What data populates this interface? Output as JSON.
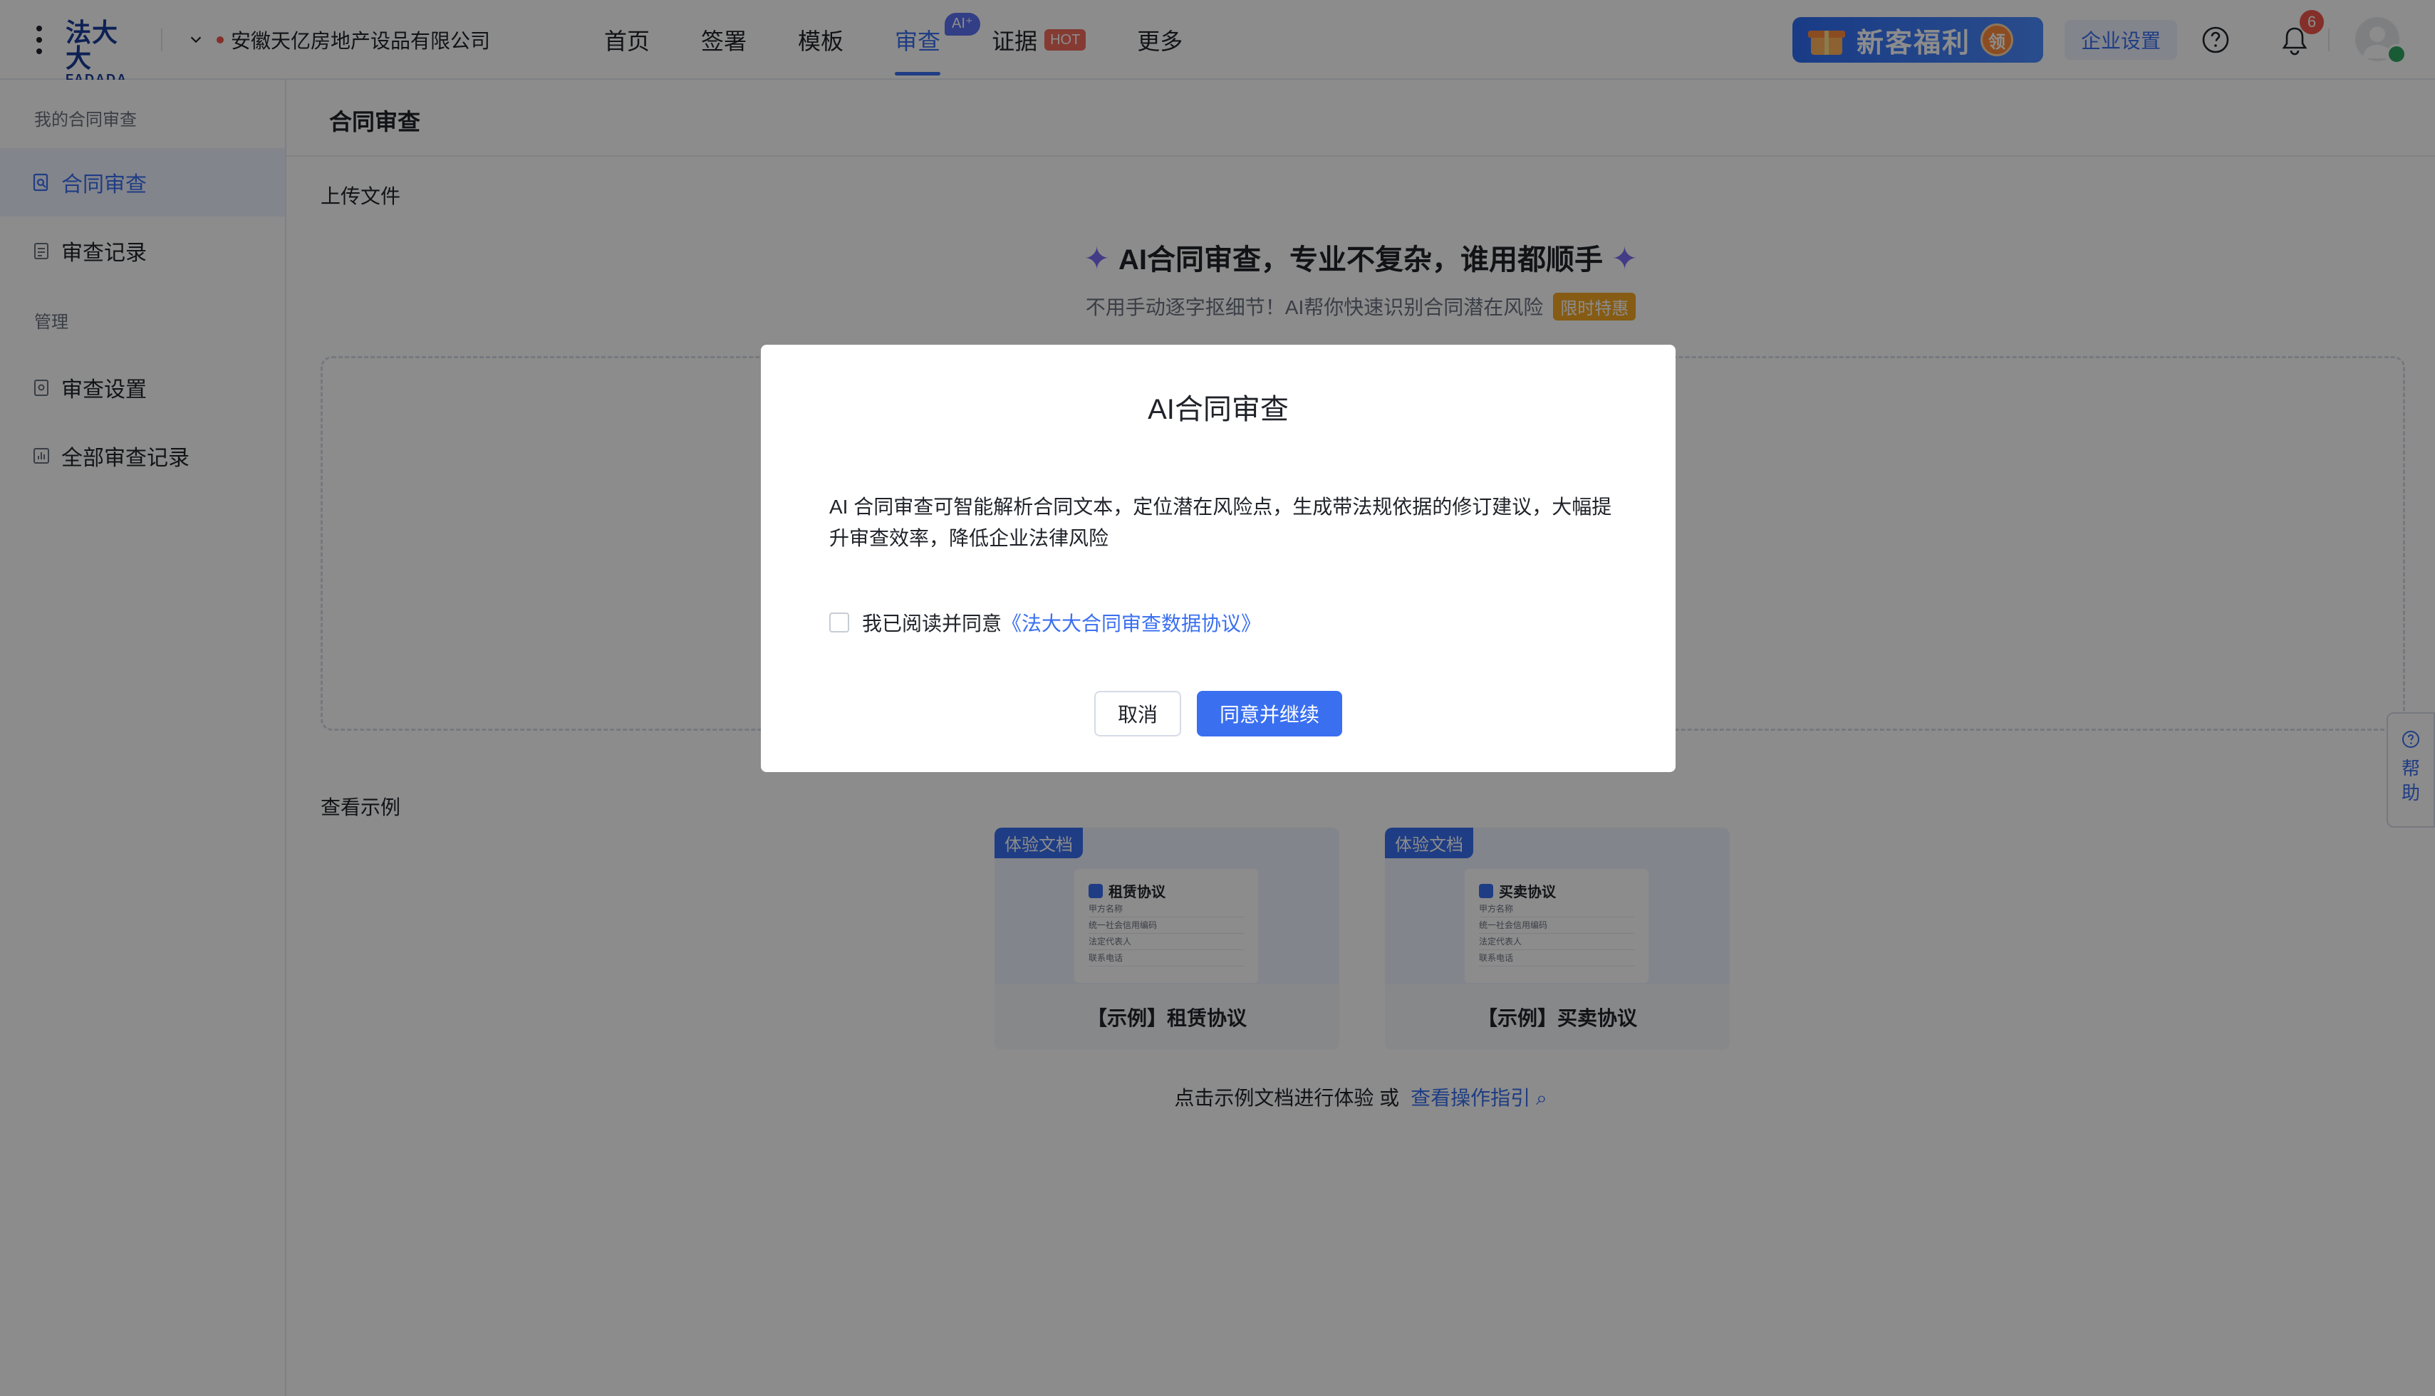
{
  "header": {
    "logo_cn": "法大大",
    "logo_en": "FADADA",
    "company": "安徽天亿房地产设品有限公司",
    "nav": [
      {
        "label": "首页"
      },
      {
        "label": "签署"
      },
      {
        "label": "模板"
      },
      {
        "label": "审查",
        "badge": "AI⁺"
      },
      {
        "label": "证据",
        "badge": "HOT"
      },
      {
        "label": "更多"
      }
    ],
    "promo_label": "新客福利",
    "promo_badge": "领",
    "enterprise_settings": "企业设置",
    "notification_count": "6"
  },
  "sidebar": {
    "group_mine": "我的合同审查",
    "items_mine": [
      {
        "label": "合同审查",
        "active": true
      },
      {
        "label": "审查记录"
      }
    ],
    "group_manage": "管理",
    "items_manage": [
      {
        "label": "审查设置"
      },
      {
        "label": "全部审查记录"
      }
    ]
  },
  "main": {
    "page_title": "合同审查",
    "upload_section": "上传文件",
    "hero_title": "AI合同审查，专业不复杂，谁用都顺手",
    "hero_subtitle": "不用手动逐字抠细节！AI帮你快速识别合同潜在风险",
    "limited_badge": "限时特惠",
    "examples_section": "查看示例",
    "examples": [
      {
        "tag": "体验文档",
        "doc_title": "租赁协议",
        "caption": "【示例】租赁协议",
        "lines": [
          "甲方名称",
          "统一社会信用编码",
          "法定代表人",
          "联系电话"
        ]
      },
      {
        "tag": "体验文档",
        "doc_title": "买卖协议",
        "caption": "【示例】买卖协议",
        "lines": [
          "甲方名称",
          "统一社会信用编码",
          "法定代表人",
          "联系电话"
        ]
      }
    ],
    "hint_text": "点击示例文档进行体验 或",
    "hint_link": "查看操作指引"
  },
  "help_float": [
    "帮",
    "助"
  ],
  "modal": {
    "title": "AI合同审查",
    "body": "AI 合同审查可智能解析合同文本，定位潜在风险点，生成带法规依据的修订建议，大幅提升审查效率，降低企业法律风险",
    "agree_prefix": "我已阅读并同意",
    "agree_link": "《法大大合同审查数据协议》",
    "cancel": "取消",
    "confirm": "同意并继续"
  },
  "colors": {
    "accent": "#3a6ff0",
    "hot": "#f26a5c",
    "limited": "#f5a623",
    "spark": "#7a6cf2"
  }
}
